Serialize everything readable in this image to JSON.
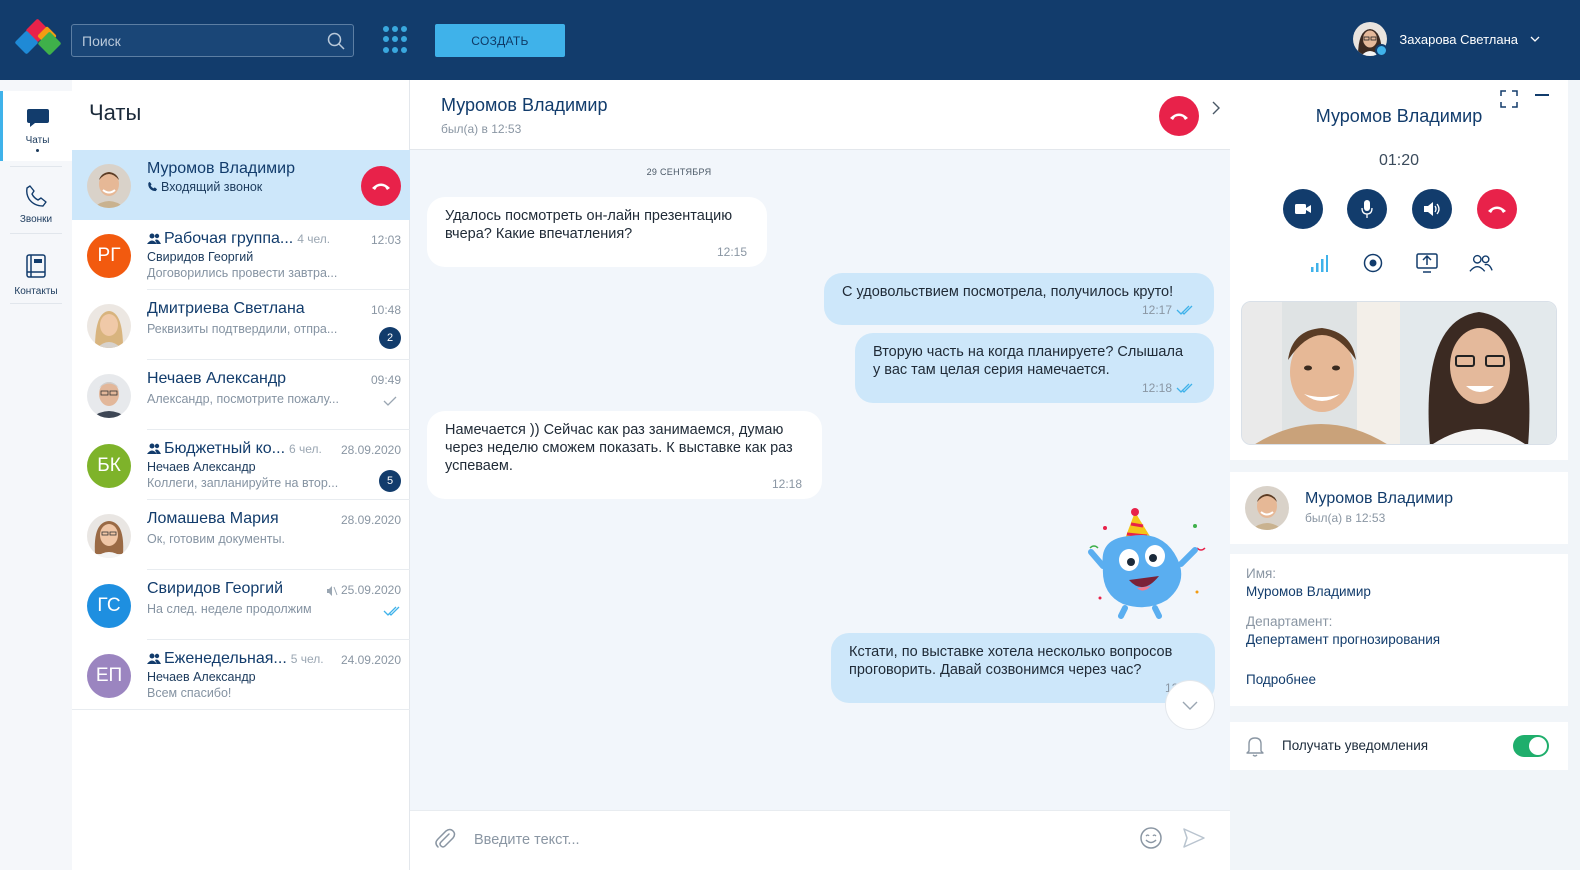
{
  "header": {
    "search_placeholder": "Поиск",
    "create_label": "Создать",
    "user_name": "Захарова Светлана",
    "logo_colors": [
      "#e8224a",
      "#f39c12",
      "#1f8ad6",
      "#3fb04a"
    ]
  },
  "rail": {
    "items": [
      {
        "label": "Чаты",
        "icon": "chat-icon",
        "active": true
      },
      {
        "label": "Звонки",
        "icon": "phone-icon",
        "active": false
      },
      {
        "label": "Контакты",
        "icon": "contacts-book-icon",
        "active": false
      }
    ]
  },
  "chatlist": {
    "title": "Чаты",
    "items": [
      {
        "name": "Муромов Владимир",
        "line1": "Входящий звонок",
        "time": "",
        "initials": ""
      },
      {
        "name": "Рабочая группа...",
        "members": "4 чел.",
        "time": "12:03",
        "line1": "Свиридов Георгий",
        "line2": "Договорились провести завтра...",
        "initials": "РГ",
        "color": "#f25a0f"
      },
      {
        "name": "Дмитриева Светлана",
        "time": "10:48",
        "line2": "Реквизиты подтвердили, отпра...",
        "badge": "2"
      },
      {
        "name": "Нечаев Александр",
        "time": "09:49",
        "line2": "Александр, посмотрите пожалу..."
      },
      {
        "name": "Бюджетный ко...",
        "members": "6 чел.",
        "time": "28.09.2020",
        "line1": "Нечаев Александр",
        "line2": "Коллеги, запланируйте на втор...",
        "badge": "5",
        "initials": "БК",
        "color": "#7eb32a"
      },
      {
        "name": "Ломашева Мария",
        "time": "28.09.2020",
        "line2": "Ок, готовим документы."
      },
      {
        "name": "Свиридов Георгий",
        "time": "25.09.2020",
        "line2": "На след. неделе продолжим",
        "initials": "ГС",
        "color": "#1e8fe0"
      },
      {
        "name": "Еженедельная...",
        "members": "5 чел.",
        "time": "24.09.2020",
        "line1": "Нечаев Александр",
        "line2": "Всем спасибо!",
        "initials": "ЕП",
        "color": "#9b85c0"
      }
    ]
  },
  "conversation": {
    "title": "Муромов Владимир",
    "status": "был(а) в 12:53",
    "date": "29 сентября",
    "messages": [
      {
        "dir": "in",
        "text": "Удалось посмотреть он-лайн презентацию вчера? Какие впечатления?",
        "time": "12:15"
      },
      {
        "dir": "out",
        "text": "С удовольствием посмотрела, получилось круто!",
        "time": "12:17"
      },
      {
        "dir": "out",
        "text": "Вторую часть на когда планируете? Слышала у вас там целая серия намечается.",
        "time": "12:18"
      },
      {
        "dir": "in",
        "text": "Намечается )) Сейчас как раз занимаемся, думаю через неделю сможем показать. К выставке как раз успеваем.",
        "time": "12:18"
      },
      {
        "dir": "out",
        "text": "Кстати, по выставке хотела несколько вопросов проговорить. Давай созвонимся через час?",
        "time": "12:20"
      }
    ],
    "composer_placeholder": "Введите текст..."
  },
  "call": {
    "name": "Муромов Владимир",
    "timer": "01:20"
  },
  "contact": {
    "name": "Муромов Владимир",
    "status": "был(а) в 12:53",
    "name_label": "Имя:",
    "name_value": "Муромов Владимир",
    "dept_label": "Департамент:",
    "dept_value": "Депертамент прогнозирования",
    "more": "Подробнее",
    "notify_label": "Получать уведомления",
    "notify_on": true
  }
}
